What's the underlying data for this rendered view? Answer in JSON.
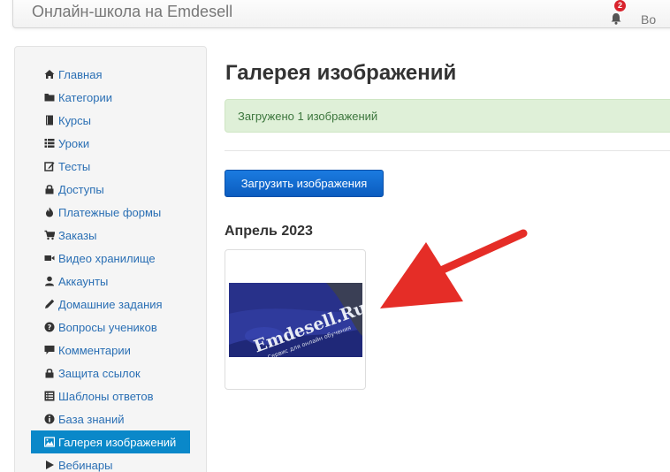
{
  "header": {
    "brand": "Онлайн-школа на Emdesell",
    "notifications_count": "2",
    "user_label": "Во"
  },
  "sidebar": {
    "items": [
      {
        "label": "Главная",
        "icon": "home-icon"
      },
      {
        "label": "Категории",
        "icon": "folder-icon"
      },
      {
        "label": "Курсы",
        "icon": "book-icon"
      },
      {
        "label": "Уроки",
        "icon": "list-icon"
      },
      {
        "label": "Тесты",
        "icon": "edit-icon"
      },
      {
        "label": "Доступы",
        "icon": "lock-icon"
      },
      {
        "label": "Платежные формы",
        "icon": "fire-icon"
      },
      {
        "label": "Заказы",
        "icon": "cart-icon"
      },
      {
        "label": "Видео хранилище",
        "icon": "video-icon"
      },
      {
        "label": "Аккаунты",
        "icon": "user-icon"
      },
      {
        "label": "Домашние задания",
        "icon": "pencil-icon"
      },
      {
        "label": "Вопросы учеников",
        "icon": "question-icon"
      },
      {
        "label": "Комментарии",
        "icon": "comment-icon"
      },
      {
        "label": "Защита ссылок",
        "icon": "lock-icon"
      },
      {
        "label": "Шаблоны ответов",
        "icon": "list-alt-icon"
      },
      {
        "label": "База знаний",
        "icon": "info-icon"
      },
      {
        "label": "Галерея изображений",
        "icon": "picture-icon",
        "active": true
      },
      {
        "label": "Вебинары",
        "icon": "play-icon"
      }
    ]
  },
  "main": {
    "title": "Галерея изображений",
    "alert": "Загружено 1 изображений",
    "upload_button": "Загрузить изображения",
    "month": "Апрель 2023",
    "image": {
      "logo_text": "Emdesell.Ru",
      "tagline": "Сервис для онлайн обучения"
    }
  },
  "colors": {
    "link": "#2a6fb4",
    "active_nav": "#0a88c9",
    "alert_bg": "#dff0d8",
    "alert_text": "#3c763d",
    "button": "#0b5cbf",
    "arrow": "#e52d27",
    "badge": "#d9232d"
  }
}
